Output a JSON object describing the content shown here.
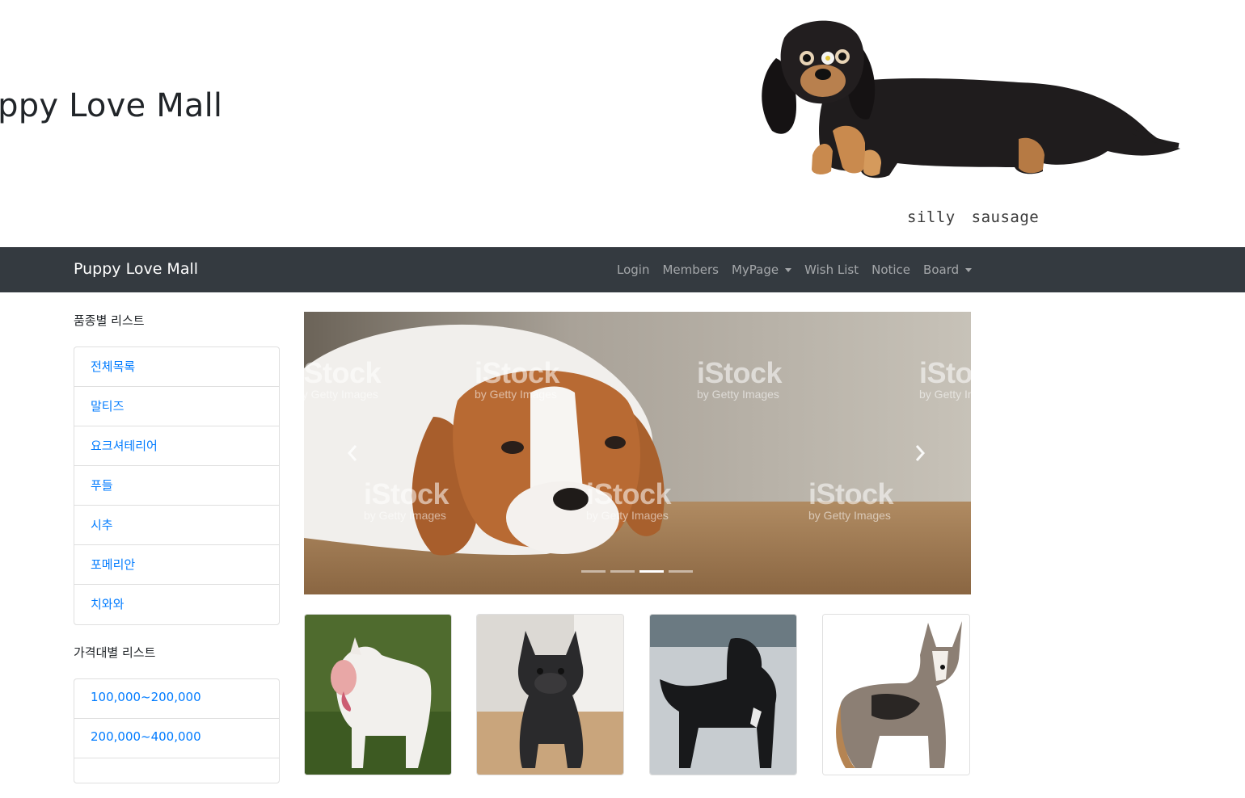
{
  "header": {
    "title": "Puppy Love Mall",
    "image_caption": "silly sausage"
  },
  "navbar": {
    "brand": "Puppy Love Mall",
    "items": [
      {
        "label": "Login",
        "dropdown": false
      },
      {
        "label": "Members",
        "dropdown": false
      },
      {
        "label": "MyPage",
        "dropdown": true
      },
      {
        "label": "Wish List",
        "dropdown": false
      },
      {
        "label": "Notice",
        "dropdown": false
      },
      {
        "label": "Board",
        "dropdown": true
      }
    ]
  },
  "sidebar": {
    "breed_heading": "품종별 리스트",
    "breeds": [
      "전체목록",
      "말티즈",
      "요크셔테리어",
      "푸들",
      "시추",
      "포메리안",
      "치와와"
    ],
    "price_heading": "가격대별 리스트",
    "prices": [
      "100,000~200,000",
      "200,000~400,000"
    ]
  },
  "carousel": {
    "watermark": "iStock",
    "watermark_sub": "by Getty Images",
    "slide_count": 4,
    "active_index": 2
  },
  "products": [
    {
      "icon": "bull-terrier-photo"
    },
    {
      "icon": "french-bulldog-photo"
    },
    {
      "icon": "staffordshire-terrier-photo"
    },
    {
      "icon": "corgi-photo"
    }
  ],
  "colors": {
    "navbar_bg": "#343a40",
    "link": "#007bff",
    "brand_text": "#ffffff"
  }
}
